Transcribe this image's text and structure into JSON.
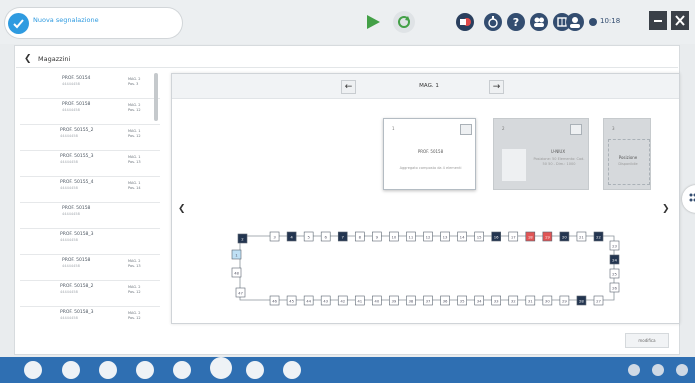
{
  "header": {
    "new_report_label": "Nuova segnalazione",
    "clock": "10:18"
  },
  "page": {
    "title": "Magazzini"
  },
  "list": {
    "items": [
      {
        "name": "PROF. 50154",
        "sub": "44444458",
        "tag1": "MAG. 2",
        "tag2": "Pos. 3"
      },
      {
        "name": "PROF. 50158",
        "sub": "44444458",
        "tag1": "MAG. 2",
        "tag2": "Pos. 12"
      },
      {
        "name": "PROF. 50155_2",
        "sub": "44444458",
        "tag1": "MAG. 1",
        "tag2": "Pos. 12"
      },
      {
        "name": "PROF. 50155_3",
        "sub": "44444458",
        "tag1": "MAG. 1",
        "tag2": "Pos. 13"
      },
      {
        "name": "PROF. 50155_4",
        "sub": "44444458",
        "tag1": "MAG. 1",
        "tag2": "Pos. 14"
      },
      {
        "name": "PROF. 50158",
        "sub": "44444458",
        "tag1": "",
        "tag2": ""
      },
      {
        "name": "PROF. 50158_3",
        "sub": "44444458",
        "tag1": "",
        "tag2": ""
      },
      {
        "name": "PROF. 50158",
        "sub": "44444458",
        "tag1": "MAG. 2",
        "tag2": "Pos. 13"
      },
      {
        "name": "PROF. 50158_2",
        "sub": "44444458",
        "tag1": "MAG. 2",
        "tag2": "Pos. 12"
      },
      {
        "name": "PROF. 50158_3",
        "sub": "44444458",
        "tag1": "MAG. 2",
        "tag2": "Pos. 12"
      }
    ]
  },
  "detail": {
    "nav_title": "MAG. 1",
    "cards": [
      {
        "index": "1",
        "name": "PROF. 50158",
        "desc": "Aggregato composto da 4 elementi"
      },
      {
        "index": "2",
        "name": "U-NIUX",
        "desc": "Posizione: 50 Elemento: Cod. 50 50 - Dim.: 1000"
      },
      {
        "index": "3",
        "name": "Posizione",
        "desc": "Disponibile"
      }
    ],
    "conveyor": {
      "top": [
        "2",
        "3",
        "4",
        "5",
        "6",
        "7",
        "8",
        "9",
        "10",
        "11",
        "12",
        "13",
        "14",
        "15",
        "16",
        "17",
        "18",
        "19",
        "20",
        "21",
        "22"
      ],
      "bottom": [
        "47",
        "46",
        "45",
        "44",
        "43",
        "42",
        "41",
        "40",
        "39",
        "38",
        "37",
        "36",
        "35",
        "34",
        "33",
        "32",
        "31",
        "30",
        "29",
        "28",
        "27"
      ],
      "right": [
        "23",
        "24",
        "25",
        "26"
      ],
      "left": [
        "1",
        "48"
      ],
      "dark": [
        "2",
        "4",
        "7",
        "16",
        "20",
        "22",
        "24",
        "28"
      ],
      "red": [
        "18",
        "19"
      ],
      "light_blue": [
        "1"
      ],
      "colors": {
        "dark": "#233550",
        "red": "#e05555",
        "light_blue": "#bfe0f5"
      }
    }
  },
  "footer": {
    "action_label": "modifica"
  }
}
